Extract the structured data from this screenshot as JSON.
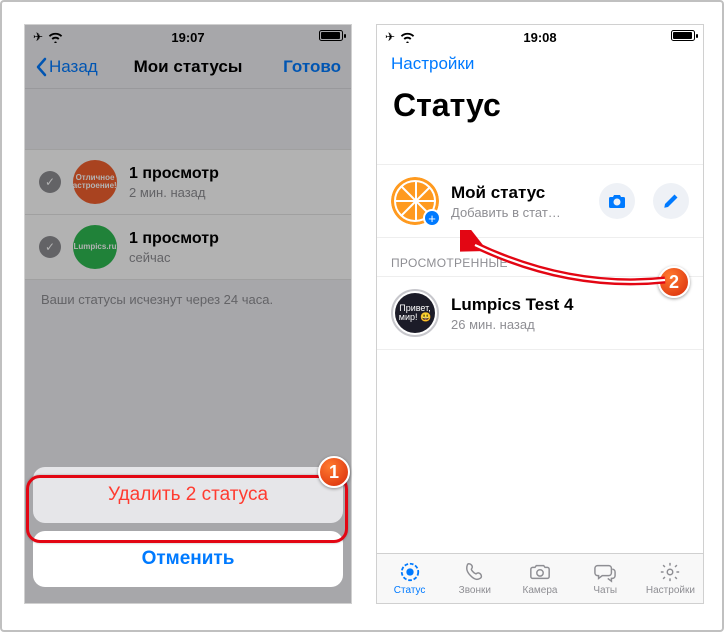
{
  "left": {
    "time": "19:07",
    "nav": {
      "back": "Назад",
      "title": "Мои статусы",
      "done": "Готово"
    },
    "items": [
      {
        "avatar_text": "Отличное настроение!!!",
        "title": "1 просмотр",
        "subtitle": "2 мин. назад"
      },
      {
        "avatar_text": "Lumpics.ru",
        "title": "1 просмотр",
        "subtitle": "сейчас"
      }
    ],
    "footer": "Ваши статусы исчезнут через 24 часа.",
    "sheet": {
      "delete": "Удалить 2 статуса",
      "cancel": "Отменить"
    }
  },
  "right": {
    "time": "19:08",
    "nav_link": "Настройки",
    "big_title": "Статус",
    "my_status": {
      "title": "Мой статус",
      "subtitle": "Добавить в стат…"
    },
    "section_viewed": "ПРОСМОТРЕННЫЕ",
    "viewed": [
      {
        "avatar_text": "Привет, мир! 😃",
        "title": "Lumpics Test 4",
        "subtitle": "26 мин. назад"
      }
    ],
    "tabs": {
      "status": "Статус",
      "calls": "Звонки",
      "camera": "Камера",
      "chats": "Чаты",
      "settings": "Настройки"
    }
  },
  "badges": {
    "one": "1",
    "two": "2"
  }
}
